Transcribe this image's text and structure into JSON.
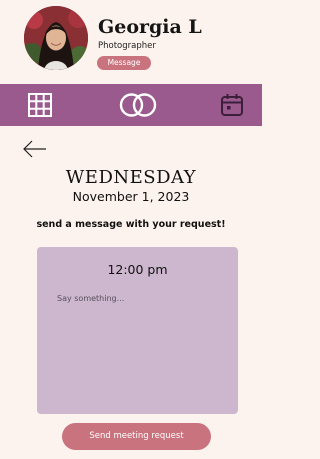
{
  "profile": {
    "name": "Georgia L",
    "role": "Photographer",
    "message_label": "Message"
  },
  "nav": {
    "background": "#9b5a8e",
    "items": [
      {
        "icon": "grid-icon"
      },
      {
        "icon": "rings-icon"
      },
      {
        "icon": "calendar-icon"
      }
    ]
  },
  "back_icon": "arrow-left-icon",
  "schedule": {
    "day": "WEDNESDAY",
    "date": "November 1, 2023",
    "instruction": "send a message with your request!"
  },
  "request": {
    "time": "12:00 pm",
    "message_placeholder": "Say something...",
    "message_value": "",
    "send_label": "Send meeting request"
  },
  "colors": {
    "page_background": "#fdf3ee",
    "accent": "#c9737e",
    "card": "#cdb7cf",
    "nav": "#9b5a8e"
  }
}
